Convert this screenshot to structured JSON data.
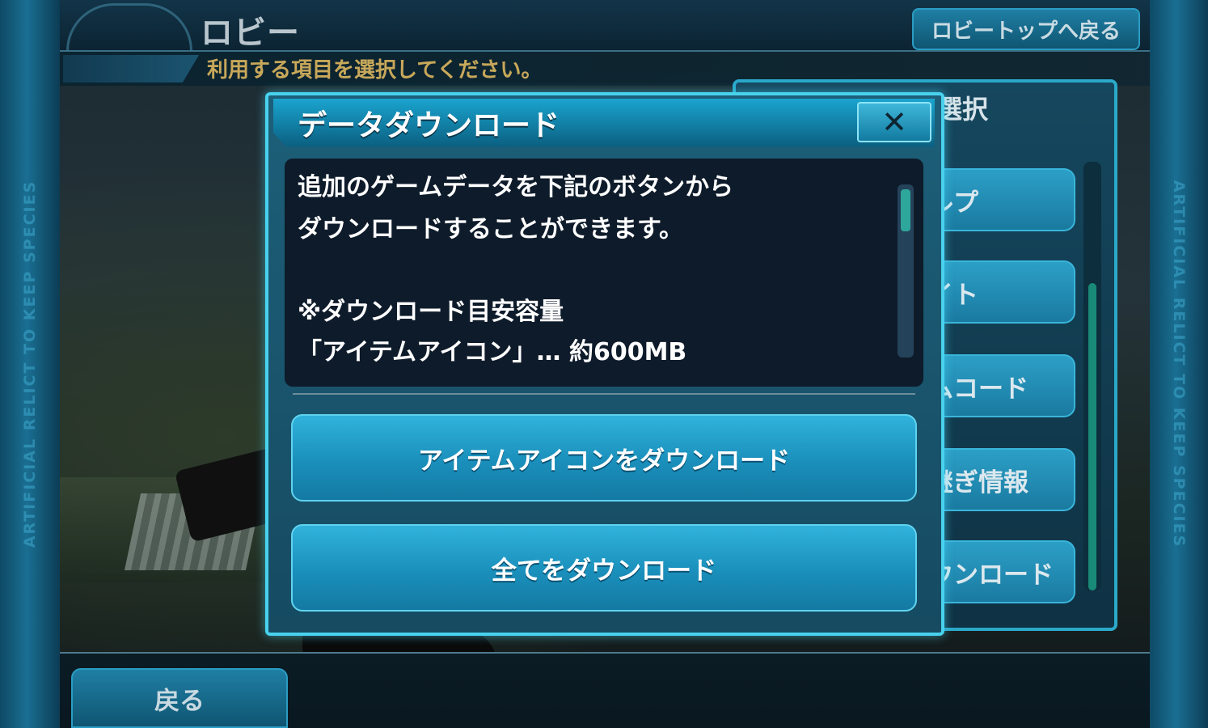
{
  "header": {
    "title": "ロビー",
    "top_return_label": "ロビートップへ戻る",
    "instruction": "利用する項目を選択してください。"
  },
  "rails": {
    "left_text": "ARTIFICIAL RELICT TO KEEP SPECIES",
    "right_text": "ARTIFICIAL RELICT TO KEEP SPECIES"
  },
  "menu": {
    "title": "選択",
    "items": [
      "ルプ",
      "イト",
      "ムコード",
      "継ぎ情報",
      "ウンロード"
    ]
  },
  "dialog": {
    "title": "データダウンロード",
    "close_label": "✕",
    "message_lines": [
      "追加のゲームデータを下記のボタンから",
      "ダウンロードすることができます。",
      "",
      "※ダウンロード目安容量",
      "「アイテムアイコン」… 約600MB"
    ],
    "buttons": {
      "item_icon_download": "アイテムアイコンをダウンロード",
      "all_download": "全てをダウンロード"
    }
  },
  "footer": {
    "back_label": "戻る"
  },
  "colors": {
    "accent": "#48d2ee",
    "button": "#1a8fbb",
    "instruction_text": "#c8a85a"
  }
}
